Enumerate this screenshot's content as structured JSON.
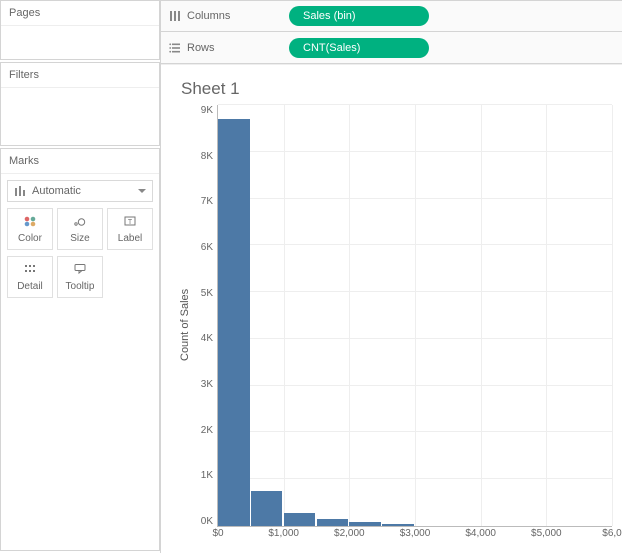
{
  "left": {
    "pages_title": "Pages",
    "filters_title": "Filters",
    "marks_title": "Marks",
    "mark_type": "Automatic",
    "buttons": {
      "color": "Color",
      "size": "Size",
      "label": "Label",
      "detail": "Detail",
      "tooltip": "Tooltip"
    }
  },
  "shelves": {
    "columns_label": "Columns",
    "rows_label": "Rows",
    "column_pill": "Sales (bin)",
    "row_pill": "CNT(Sales)"
  },
  "sheet": {
    "title": "Sheet 1",
    "ylabel": "Count of Sales"
  },
  "chart_data": {
    "type": "bar",
    "title": "Sheet 1",
    "xlabel": "",
    "ylabel": "Count of Sales",
    "bin_width": 500,
    "x_bins_start": [
      0,
      500,
      1000,
      1500,
      2000,
      2500
    ],
    "values": [
      8700,
      750,
      280,
      150,
      80,
      40
    ],
    "ylim": [
      0,
      9000
    ],
    "yticks": [
      0,
      1000,
      2000,
      3000,
      4000,
      5000,
      6000,
      7000,
      8000,
      9000
    ],
    "ytick_labels": [
      "0K",
      "1K",
      "2K",
      "3K",
      "4K",
      "5K",
      "6K",
      "7K",
      "8K",
      "9K"
    ],
    "xticks": [
      0,
      1000,
      2000,
      3000,
      4000,
      5000,
      6000
    ],
    "xtick_labels": [
      "$0",
      "$1,000",
      "$2,000",
      "$3,000",
      "$4,000",
      "$5,000",
      "$6,0"
    ],
    "xlim": [
      0,
      6000
    ]
  }
}
